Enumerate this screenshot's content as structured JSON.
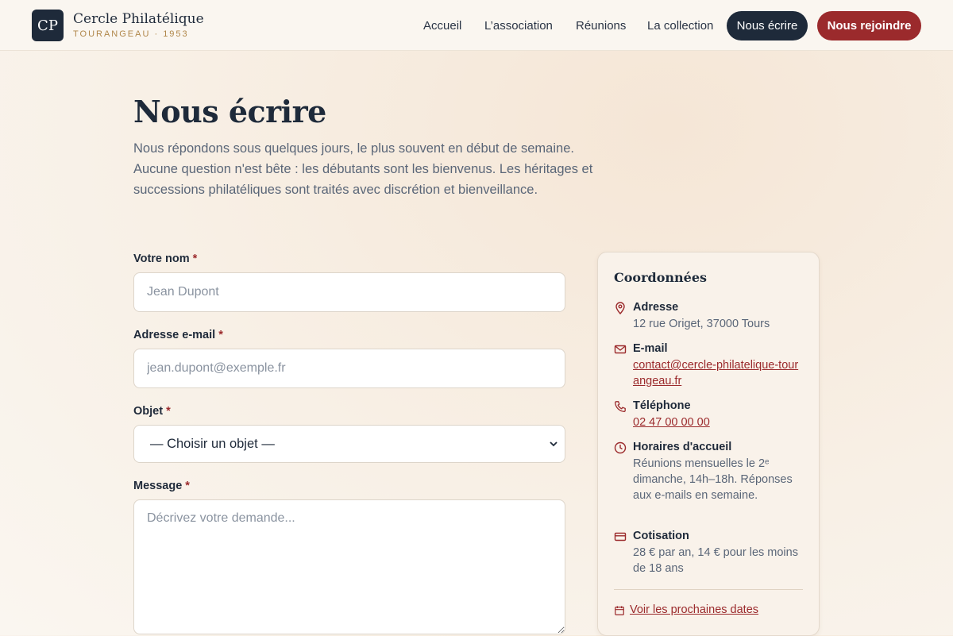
{
  "brand": {
    "initials": "CP",
    "name": "Cercle Philatélique",
    "subtitle": "TOURANGEAU · 1953"
  },
  "nav": {
    "links": [
      "Accueil",
      "L’association",
      "Réunions",
      "La collection"
    ],
    "active": "Nous écrire",
    "cta": "Nous rejoindre"
  },
  "page": {
    "title": "Nous écrire",
    "intro": "Nous répondons sous quelques jours, le plus souvent en début de semaine. Aucune question n'est bête : les débutants sont les bienvenus. Les héritages et successions philatéliques sont traités avec discrétion et bienveillance."
  },
  "form": {
    "name_label": "Votre nom",
    "name_placeholder": "Jean Dupont",
    "email_label": "Adresse e-mail",
    "email_placeholder": "jean.dupont@exemple.fr",
    "subject_label": "Objet",
    "subject_value": "— Choisir un objet —",
    "message_label": "Message",
    "message_placeholder": "Décrivez votre demande...",
    "required_mark": "*"
  },
  "contact": {
    "title": "Coordonnées",
    "address_label": "Adresse",
    "address_value": "12 rue Origet, 37000 Tours",
    "email_label": "E-mail",
    "email_value": "contact@cercle-philatelique-tourangeau.fr",
    "phone_label": "Téléphone",
    "phone_value": "02 47 00 00 00",
    "hours_label": "Horaires d'accueil",
    "hours_value": "Réunions mensuelles le 2ᵉ dimanche, 14h–18h. Réponses aux e-mails en semaine.",
    "fee_label": "Cotisation",
    "fee_value": "28 € par an, 14 € pour les moins de 18 ans",
    "dates_link": "Voir les prochaines dates"
  },
  "colors": {
    "accent": "#9b2a2c",
    "navy": "#1e2a3a",
    "gold": "#b0874a"
  }
}
